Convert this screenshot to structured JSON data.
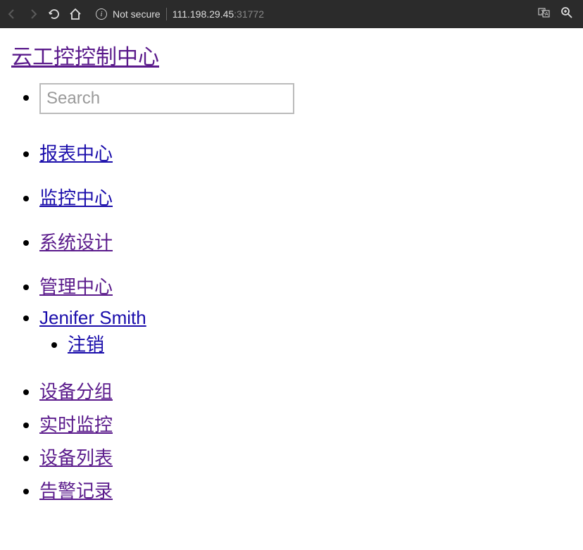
{
  "toolbar": {
    "not_secure": "Not secure",
    "host": "111.198.29.45",
    "port": ":31772"
  },
  "brand": "云工控控制中心",
  "search": {
    "placeholder": "Search",
    "value": ""
  },
  "nav_primary": [
    {
      "label": "报表中心",
      "visited": false
    },
    {
      "label": "监控中心",
      "visited": false
    },
    {
      "label": "系统设计",
      "visited": true
    }
  ],
  "nav_admin": {
    "label": "管理中心",
    "visited": true
  },
  "user": {
    "name": " Jenifer Smith",
    "logout": "注销"
  },
  "nav_secondary": [
    {
      "label": "设备分组",
      "visited": true
    },
    {
      "label": "实时监控",
      "visited": true
    },
    {
      "label": "设备列表",
      "visited": true
    },
    {
      "label": "告警记录",
      "visited": true
    }
  ]
}
